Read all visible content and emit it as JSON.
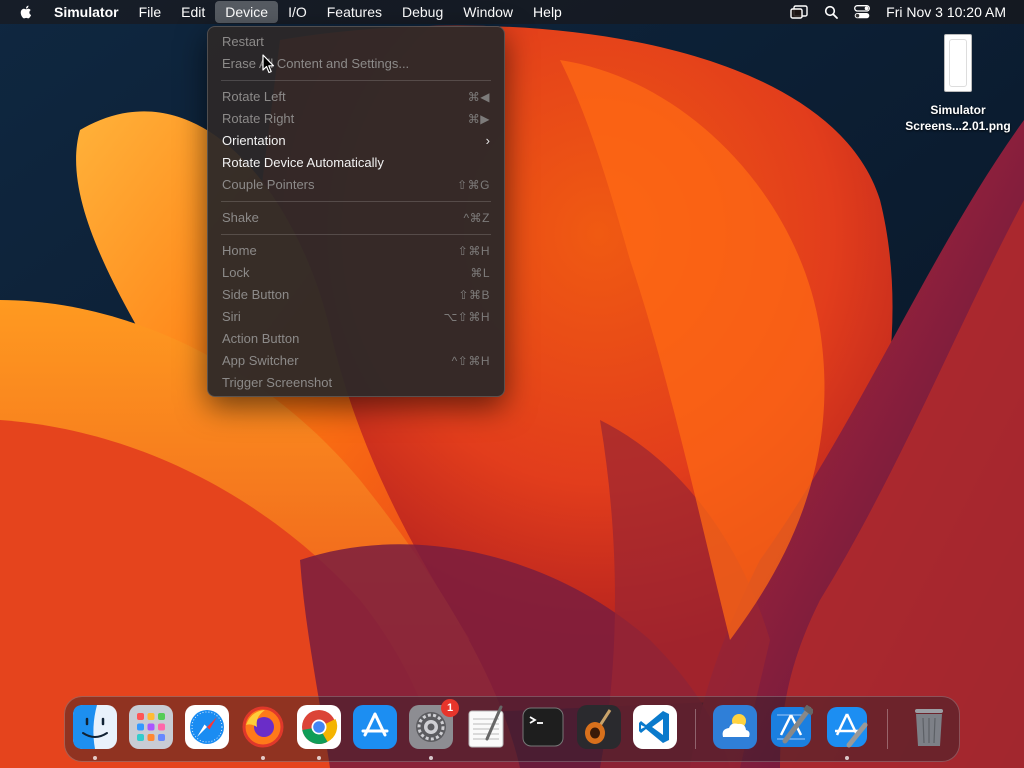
{
  "menubar": {
    "app_name": "Simulator",
    "menus": [
      "File",
      "Edit",
      "Device",
      "I/O",
      "Features",
      "Debug",
      "Window",
      "Help"
    ],
    "active_menu": "Device",
    "clock": "Fri Nov 3  10:20 AM",
    "status_icons": [
      "window-switcher-icon",
      "spotlight-search-icon",
      "control-center-icon"
    ]
  },
  "device_menu": {
    "items": [
      {
        "label": "Restart",
        "enabled": false,
        "shortcut": ""
      },
      {
        "label": "Erase All Content and Settings...",
        "enabled": false,
        "shortcut": ""
      },
      {
        "label": "Rotate Left",
        "enabled": false,
        "shortcut": "⌘◀"
      },
      {
        "label": "Rotate Right",
        "enabled": false,
        "shortcut": "⌘▶"
      },
      {
        "label": "Orientation",
        "enabled": true,
        "submenu": true
      },
      {
        "label": "Rotate Device Automatically",
        "enabled": true,
        "shortcut": ""
      },
      {
        "label": "Couple Pointers",
        "enabled": false,
        "shortcut": "⇧⌘G"
      },
      {
        "label": "Shake",
        "enabled": false,
        "shortcut": "^⌘Z"
      },
      {
        "label": "Home",
        "enabled": false,
        "shortcut": "⇧⌘H"
      },
      {
        "label": "Lock",
        "enabled": false,
        "shortcut": "⌘L"
      },
      {
        "label": "Side Button",
        "enabled": false,
        "shortcut": "⇧⌘B"
      },
      {
        "label": "Siri",
        "enabled": false,
        "shortcut": "⌥⇧⌘H"
      },
      {
        "label": "Action Button",
        "enabled": false,
        "shortcut": ""
      },
      {
        "label": "App Switcher",
        "enabled": false,
        "shortcut": "^⇧⌘H"
      },
      {
        "label": "Trigger Screenshot",
        "enabled": false,
        "shortcut": ""
      }
    ]
  },
  "desktop": {
    "file_name_line1": "Simulator",
    "file_name_line2": "Screens...2.01.png"
  },
  "dock": {
    "apps": [
      {
        "name": "finder-icon",
        "running": true
      },
      {
        "name": "launchpad-icon",
        "running": false
      },
      {
        "name": "safari-icon",
        "running": false
      },
      {
        "name": "firefox-icon",
        "running": true
      },
      {
        "name": "chrome-icon",
        "running": true
      },
      {
        "name": "app-store-icon",
        "running": false
      },
      {
        "name": "system-settings-icon",
        "running": true,
        "badge": "1"
      },
      {
        "name": "textedit-icon",
        "running": false
      },
      {
        "name": "terminal-icon",
        "running": false
      },
      {
        "name": "garageband-icon",
        "running": false
      },
      {
        "name": "vscode-icon",
        "running": false
      },
      {
        "name": "weather-icon",
        "running": false
      },
      {
        "name": "xcode-icon",
        "running": false
      },
      {
        "name": "simulator-icon",
        "running": true
      },
      {
        "name": "trash-icon",
        "running": false
      }
    ],
    "badge_count": "1"
  },
  "colors": {
    "menu_bg": "#2c2828",
    "menu_text_enabled": "#f2f2f2",
    "menu_text_disabled": "#8c8a89",
    "badge": "#e7352b"
  }
}
